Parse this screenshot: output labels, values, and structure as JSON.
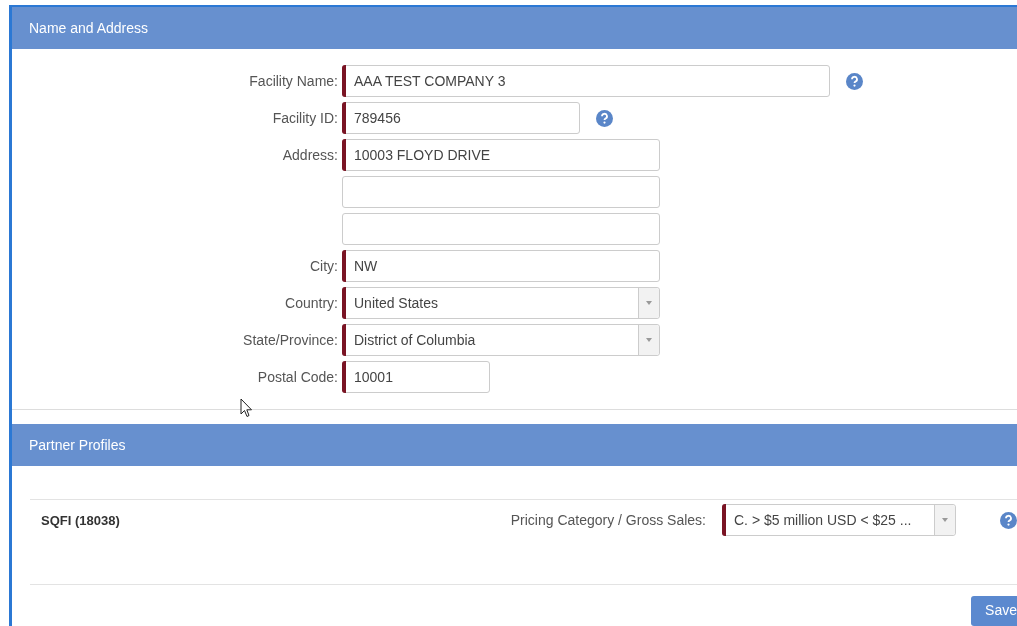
{
  "sections": [
    {
      "title": "Name and Address",
      "fields": [
        {
          "kind": "text",
          "label": "Facility Name:",
          "value": "AAA TEST COMPANY 3",
          "required": true,
          "help": true
        },
        {
          "kind": "text",
          "label": "Facility ID:",
          "value": "789456",
          "required": true,
          "help": true
        },
        {
          "kind": "text",
          "label": "Address:",
          "value": "10003 FLOYD DRIVE",
          "required": true,
          "help": false
        },
        {
          "kind": "text",
          "required": false,
          "help": false
        },
        {
          "kind": "text",
          "required": false,
          "help": false
        },
        {
          "kind": "text",
          "label": "City:",
          "value": "NW",
          "required": true,
          "help": false
        },
        {
          "kind": "select",
          "label": "Country:",
          "value": "United States",
          "required": true,
          "help": false
        },
        {
          "kind": "select",
          "label": "State/Province:",
          "value": "District of Columbia",
          "required": true,
          "help": false
        },
        {
          "kind": "text",
          "label": "Postal Code:",
          "value": "10001",
          "required": true,
          "help": false
        }
      ]
    },
    {
      "title": "Partner Profiles",
      "partners": [
        {
          "name": "SQFI (18038)",
          "field_label": "Pricing Category / Gross Sales:",
          "kind": "select",
          "value": "C. > $5 million USD < $25 ...",
          "required": true,
          "help": true
        }
      ]
    }
  ],
  "save_button": "Save"
}
